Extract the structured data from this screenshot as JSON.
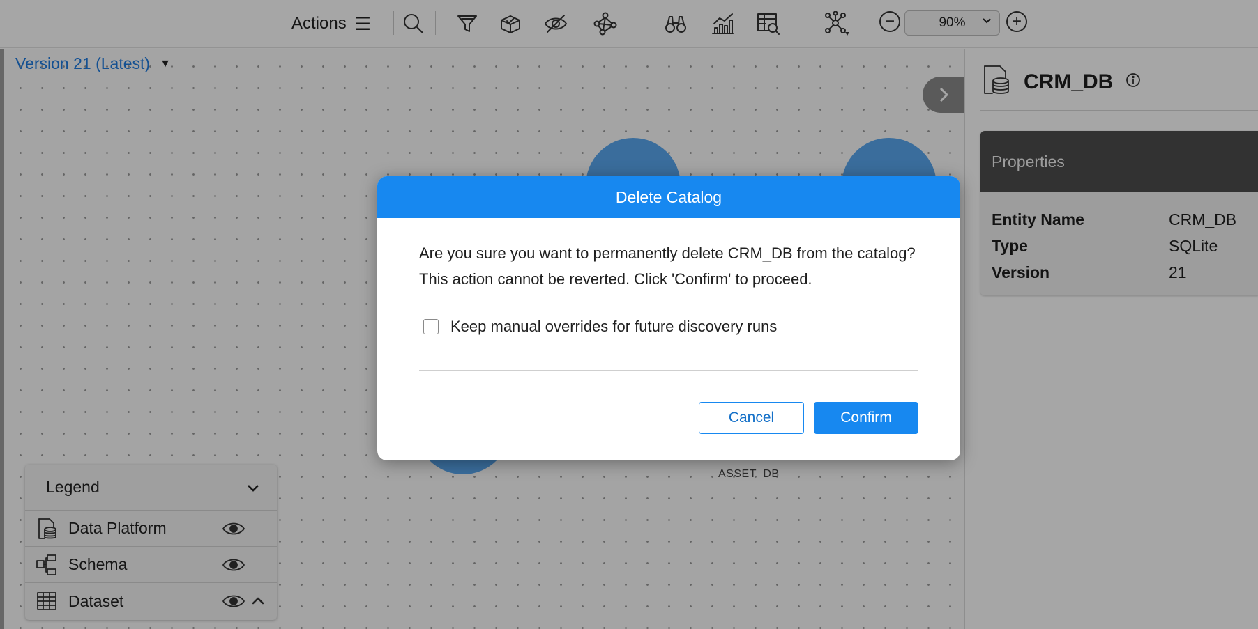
{
  "toolbar": {
    "actions_label": "Actions",
    "actions_icon": "☰",
    "zoom_value": "90%",
    "zoom_out_symbol": "−",
    "zoom_in_symbol": "+"
  },
  "canvas": {
    "version_label": "Version 21 (Latest)",
    "version_caret": "▼",
    "node_label": "ASSET_DB"
  },
  "legend": {
    "title": "Legend",
    "items": [
      {
        "label": "Data Platform",
        "icon": "database-icon"
      },
      {
        "label": "Schema",
        "icon": "schema-icon"
      },
      {
        "label": "Dataset",
        "icon": "table-icon"
      }
    ]
  },
  "panel": {
    "title": "CRM_DB",
    "properties_title": "Properties",
    "properties": [
      {
        "key": "Entity Name",
        "value": "CRM_DB"
      },
      {
        "key": "Type",
        "value": "SQLite"
      },
      {
        "key": "Version",
        "value": "21"
      }
    ]
  },
  "modal": {
    "title": "Delete Catalog",
    "message_line1": "Are you sure you want to permanently delete CRM_DB from the catalog?",
    "message_line2": "This action cannot be reverted. Click 'Confirm' to proceed.",
    "checkbox_label": "Keep manual overrides for future discovery runs",
    "checkbox_checked": false,
    "cancel_label": "Cancel",
    "confirm_label": "Confirm"
  },
  "colors": {
    "accent": "#1788f0",
    "version_link": "#1e7be0",
    "properties_header": "#4d4d4d"
  }
}
